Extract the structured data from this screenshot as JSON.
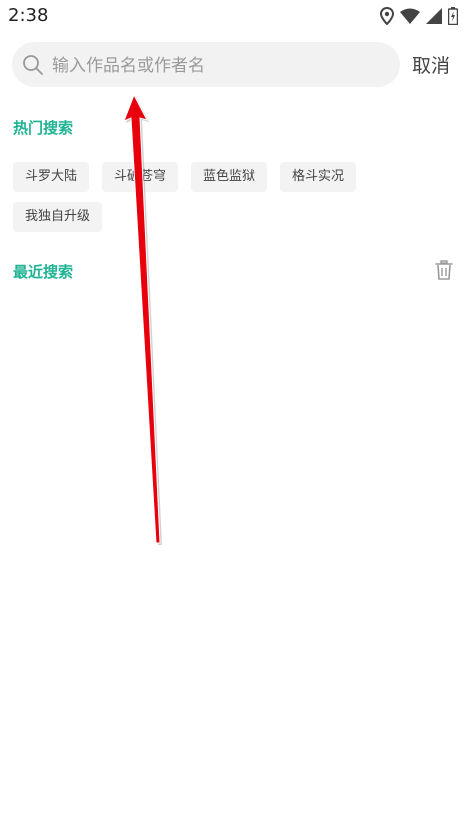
{
  "status_bar": {
    "time": "2:38"
  },
  "search": {
    "placeholder": "输入作品名或作者名",
    "value": "",
    "cancel_label": "取消"
  },
  "hot_search": {
    "title": "热门搜索",
    "tags": [
      "斗罗大陆",
      "斗破苍穹",
      "蓝色监狱",
      "格斗实况",
      "我独自升级"
    ]
  },
  "recent_search": {
    "title": "最近搜索"
  },
  "colors": {
    "accent": "#1fb394",
    "annotation_arrow": "#e8000d"
  },
  "icons": [
    "location-icon",
    "wifi-icon",
    "signal-icon",
    "battery-icon",
    "search-icon",
    "trash-icon"
  ]
}
